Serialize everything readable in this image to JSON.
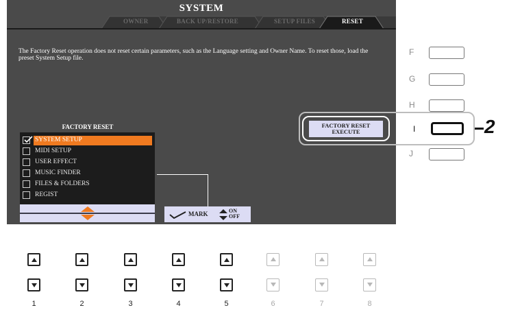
{
  "screen": {
    "title": "SYSTEM",
    "tabs": [
      {
        "label": "OWNER",
        "active": false
      },
      {
        "label": "BACK UP/RESTORE",
        "active": false
      },
      {
        "label": "SETUP FILES",
        "active": false
      },
      {
        "label": "RESET",
        "active": true
      }
    ],
    "info_text": "The Factory Reset operation does not reset certain parameters, such as the Language setting and Owner Name. To reset those, load the preset System Setup file.",
    "factory_reset": {
      "title": "FACTORY RESET",
      "items": [
        {
          "label": "SYSTEM SETUP",
          "checked": true,
          "selected": true
        },
        {
          "label": "MIDI SETUP",
          "checked": false,
          "selected": false
        },
        {
          "label": "USER EFFECT",
          "checked": false,
          "selected": false
        },
        {
          "label": "MUSIC FINDER",
          "checked": false,
          "selected": false
        },
        {
          "label": "FILES & FOLDERS",
          "checked": false,
          "selected": false
        },
        {
          "label": "REGIST",
          "checked": false,
          "selected": false
        }
      ]
    },
    "mark_button": {
      "label": "MARK",
      "on": "ON",
      "off": "OFF"
    },
    "execute_button": {
      "line1": "FACTORY RESET",
      "line2": "EXECUTE"
    }
  },
  "side_buttons": [
    {
      "letter": "F"
    },
    {
      "letter": "G"
    },
    {
      "letter": "H"
    },
    {
      "letter": "I"
    },
    {
      "letter": "J"
    }
  ],
  "callout_number": "2",
  "bottom_buttons": [
    {
      "number": "1",
      "enabled": true
    },
    {
      "number": "2",
      "enabled": true
    },
    {
      "number": "3",
      "enabled": true
    },
    {
      "number": "4",
      "enabled": true
    },
    {
      "number": "5",
      "enabled": true
    },
    {
      "number": "6",
      "enabled": false
    },
    {
      "number": "7",
      "enabled": false
    },
    {
      "number": "8",
      "enabled": false
    }
  ],
  "colors": {
    "screen_bg": "#4a4a4a",
    "highlight": "#f07a20",
    "button_face": "#dcdcf4"
  }
}
